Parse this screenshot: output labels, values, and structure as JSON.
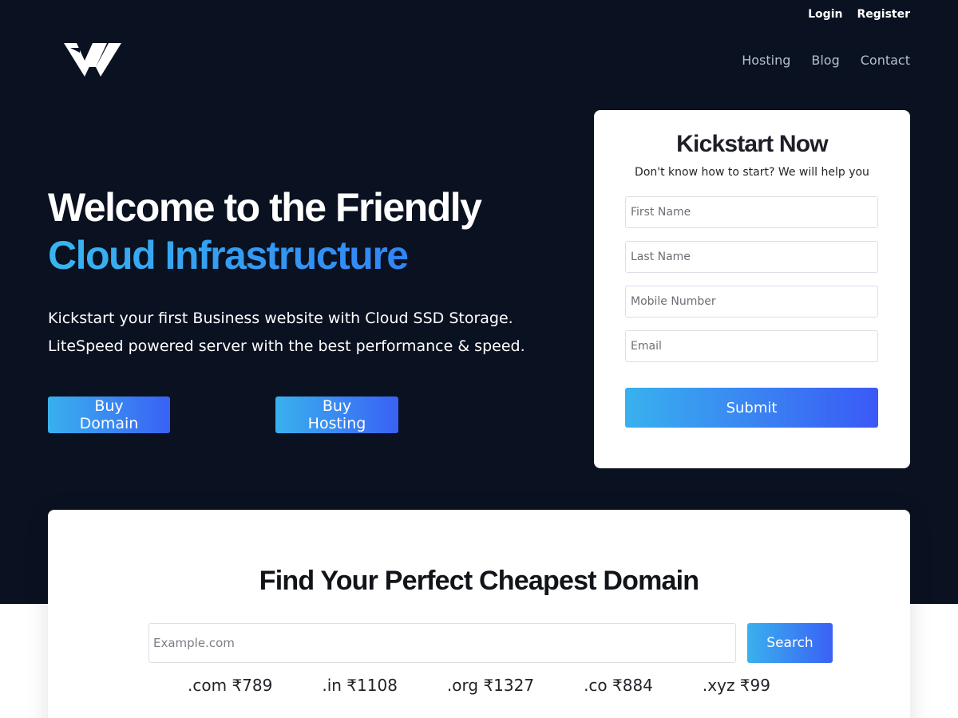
{
  "header": {
    "top_links": {
      "login": "Login",
      "register": "Register"
    },
    "logo_icon": "w-logo-icon",
    "nav": [
      {
        "label": "Hosting"
      },
      {
        "label": "Blog"
      },
      {
        "label": "Contact"
      }
    ]
  },
  "hero": {
    "headline_line1": "Welcome to the Friendly",
    "headline_line2": "Cloud Infrastructure",
    "sub_line1": "Kickstart your first Business website with Cloud SSD Storage.",
    "sub_line2": "LiteSpeed powered server with the best performance & speed.",
    "buy_domain": "Buy Domain",
    "buy_hosting": "Buy Hosting"
  },
  "form": {
    "title": "Kickstart Now",
    "subtitle": "Don't know how to start? We will help you",
    "first_name": {
      "placeholder": "First Name",
      "value": ""
    },
    "last_name": {
      "placeholder": "Last Name",
      "value": ""
    },
    "mobile": {
      "placeholder": "Mobile Number",
      "value": ""
    },
    "email": {
      "placeholder": "Email",
      "value": ""
    },
    "submit": "Submit"
  },
  "domain": {
    "title": "Find Your Perfect Cheapest Domain",
    "search_placeholder": "Example.com",
    "search_value": "",
    "search_button": "Search",
    "prices": [
      {
        "text": ".com ₹789"
      },
      {
        "text": ".in ₹1108"
      },
      {
        "text": ".org ₹1327"
      },
      {
        "text": ".co ₹884"
      },
      {
        "text": ".xyz ₹99"
      }
    ]
  },
  "colors": {
    "hero_bg": "#0a1120",
    "accent_start": "#39b1ee",
    "accent_end": "#3a61f5",
    "nav_text": "#b4bfd1"
  }
}
